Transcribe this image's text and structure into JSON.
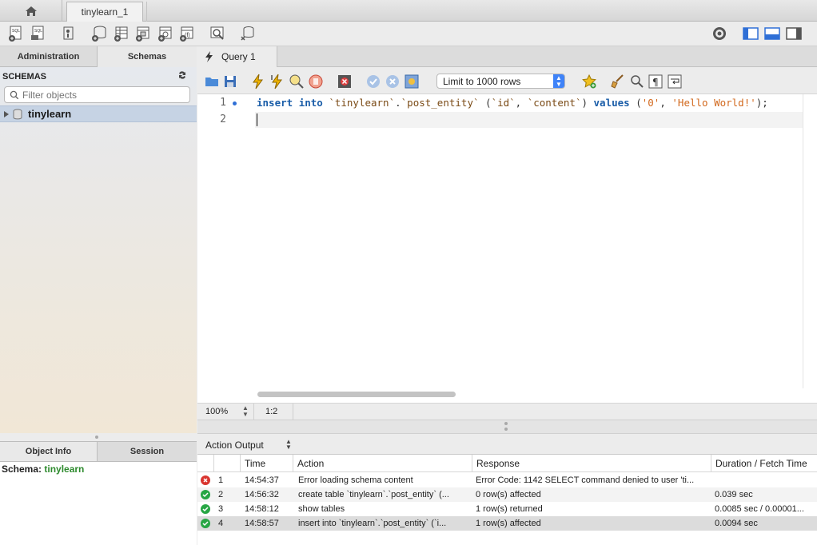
{
  "tabs": {
    "connection_tab": "tinylearn_1"
  },
  "sidebar": {
    "tabs": [
      "Administration",
      "Schemas"
    ],
    "schemas_title": "SCHEMAS",
    "filter_placeholder": "Filter objects",
    "schema_name": "tinylearn",
    "info_tabs": [
      "Object Info",
      "Session"
    ],
    "info_label": "Schema:",
    "info_value": "tinylearn"
  },
  "editor": {
    "query_tab": "Query 1",
    "limit_select": "Limit to 1000 rows",
    "line_numbers": [
      "1",
      "2"
    ],
    "code_line1": {
      "kw1": "insert",
      "kw2": "into",
      "schema": "`tinylearn`",
      "dot": ".",
      "table": "`post_entity`",
      "open": "(",
      "col1": "`id`",
      "comma1": ",",
      "col2": "`content`",
      "close": ")",
      "kw3": "values",
      "open2": "(",
      "val1": "'0'",
      "comma2": ",",
      "val2": "'Hello World!'",
      "close2": ");"
    },
    "zoom": "100%",
    "cursor_position": "1:2"
  },
  "output": {
    "title": "Action Output",
    "columns": [
      "",
      "Time",
      "Action",
      "Response",
      "Duration / Fetch Time"
    ],
    "rows": [
      {
        "status": "error",
        "n": "1",
        "time": "14:54:37",
        "action": "Error loading schema content",
        "response": "Error Code: 1142 SELECT command denied to user 'ti...",
        "duration": ""
      },
      {
        "status": "ok",
        "n": "2",
        "time": "14:56:32",
        "action": "create table `tinylearn`.`post_entity` (...",
        "response": "0 row(s) affected",
        "duration": "0.039 sec"
      },
      {
        "status": "ok",
        "n": "3",
        "time": "14:58:12",
        "action": "show tables",
        "response": "1 row(s) returned",
        "duration": "0.0085 sec / 0.00001..."
      },
      {
        "status": "ok",
        "n": "4",
        "time": "14:58:57",
        "action": "insert into `tinylearn`.`post_entity` (`i...",
        "response": "1 row(s) affected",
        "duration": "0.0094 sec"
      }
    ]
  },
  "colors": {
    "accent": "#3f83f8",
    "ok": "#27a644",
    "error": "#d9352f",
    "keyword": "#1a5da8",
    "string": "#d2691e",
    "schema_value": "#2d8a2d"
  }
}
